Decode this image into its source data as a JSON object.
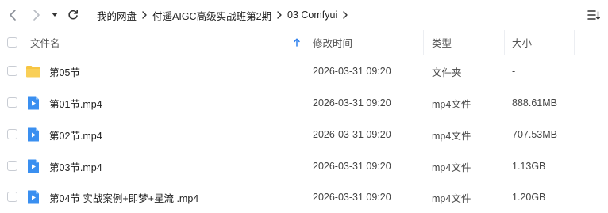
{
  "toolbar": {
    "breadcrumbs": [
      "我的网盘",
      "付遥AIGC高级实战班第2期",
      "03 Comfyui"
    ]
  },
  "columns": {
    "name": "文件名",
    "modified": "修改时间",
    "type": "类型",
    "size": "大小"
  },
  "files": [
    {
      "name": "第05节",
      "modified": "2026-03-31 09:20",
      "type": "文件夹",
      "size": "-",
      "icon": "folder-icon"
    },
    {
      "name": "第01节.mp4",
      "modified": "2026-03-31 09:20",
      "type": "mp4文件",
      "size": "888.61MB",
      "icon": "video-file-icon"
    },
    {
      "name": "第02节.mp4",
      "modified": "2026-03-31 09:20",
      "type": "mp4文件",
      "size": "707.53MB",
      "icon": "video-file-icon"
    },
    {
      "name": "第03节.mp4",
      "modified": "2026-03-31 09:20",
      "type": "mp4文件",
      "size": "1.13GB",
      "icon": "video-file-icon"
    },
    {
      "name": "第04节 实战案例+即梦+星流 .mp4",
      "modified": "2026-03-31 09:20",
      "type": "mp4文件",
      "size": "1.20GB",
      "icon": "video-file-icon"
    }
  ],
  "colors": {
    "folder": "#f7c542",
    "video": "#3a8ff0",
    "sort_arrow": "#2f80ed"
  }
}
